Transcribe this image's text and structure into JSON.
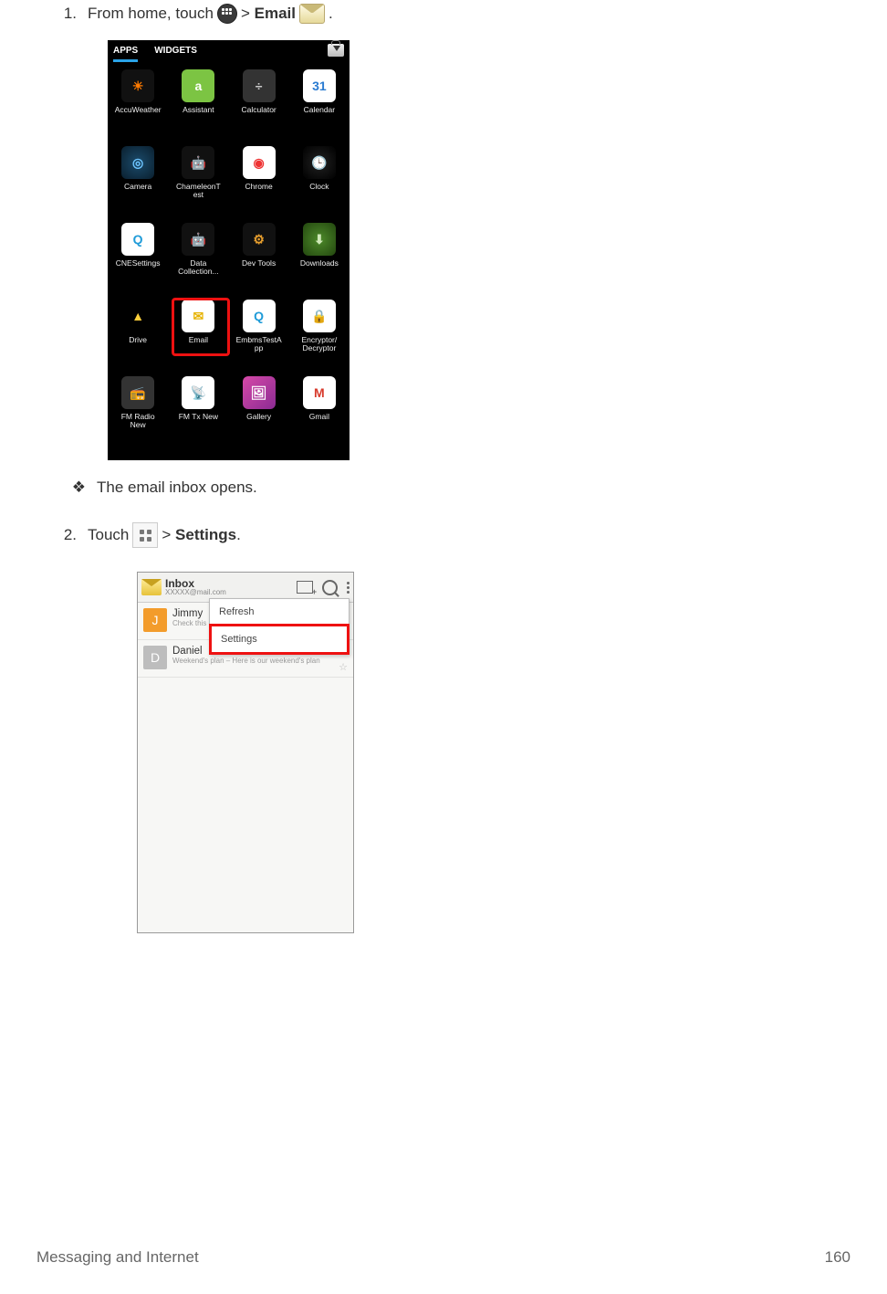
{
  "step1": {
    "number": "1.",
    "pre": "From home, touch",
    "gt1": ">",
    "email_label": "Email",
    "period": "."
  },
  "shot1": {
    "tab_apps": "APPS",
    "tab_widgets": "WIDGETS",
    "apps": [
      {
        "label": "AccuWeather",
        "bg": "#111",
        "inner": "☀",
        "ic": "#ff7a00"
      },
      {
        "label": "Assistant",
        "bg": "#7cc443",
        "inner": "a",
        "ic": "#fff"
      },
      {
        "label": "Calculator",
        "bg": "#333",
        "inner": "÷",
        "ic": "#ccc"
      },
      {
        "label": "Calendar",
        "bg": "#fff",
        "inner": "31",
        "ic": "#2a7bd1"
      },
      {
        "label": "Camera",
        "bg": "radial-gradient(circle,#1b4b6b,#0a1f2e)",
        "inner": "◎",
        "ic": "#6ec5ff"
      },
      {
        "label": "ChameleonT\nest",
        "bg": "#111",
        "inner": "🤖",
        "ic": "#8fd14f"
      },
      {
        "label": "Chrome",
        "bg": "#fff",
        "inner": "◉",
        "ic": "#e33"
      },
      {
        "label": "Clock",
        "bg": "radial-gradient(circle,#222,#000)",
        "inner": "🕒",
        "ic": "#eee"
      },
      {
        "label": "CNESettings",
        "bg": "#fff",
        "inner": "Q",
        "ic": "#1f9bd8"
      },
      {
        "label": "Data\nCollection...",
        "bg": "#111",
        "inner": "🤖",
        "ic": "#8fd14f"
      },
      {
        "label": "Dev Tools",
        "bg": "#111",
        "inner": "⚙",
        "ic": "#e89f2e"
      },
      {
        "label": "Downloads",
        "bg": "radial-gradient(circle,#4d8a2a,#23470f)",
        "inner": "⬇",
        "ic": "#cfe8b8"
      },
      {
        "label": "Drive",
        "bg": "#000",
        "inner": "▲",
        "ic": "#ffcf3a"
      },
      {
        "label": "Email",
        "bg": "#fff",
        "inner": "✉",
        "ic": "#e6b200"
      },
      {
        "label": "EmbmsTestA\npp",
        "bg": "#fff",
        "inner": "Q",
        "ic": "#1f9bd8"
      },
      {
        "label": "Encryptor/\nDecryptor",
        "bg": "#fff",
        "inner": "🔒",
        "ic": "#c33"
      },
      {
        "label": "FM Radio\nNew",
        "bg": "#333",
        "inner": "📻",
        "ic": "#aaa"
      },
      {
        "label": "FM Tx New",
        "bg": "#fff",
        "inner": "📡",
        "ic": "#555"
      },
      {
        "label": "Gallery",
        "bg": "linear-gradient(135deg,#d649a8,#8b2b93)",
        "inner": "🖼",
        "ic": "#fff"
      },
      {
        "label": "Gmail",
        "bg": "#fff",
        "inner": "M",
        "ic": "#d73a2c"
      }
    ]
  },
  "bullet": {
    "text": "The email inbox opens."
  },
  "step2": {
    "number": "2.",
    "pre": "Touch",
    "gt": ">",
    "settings_label": "Settings",
    "period": "."
  },
  "shot2": {
    "title": "Inbox",
    "account": "XXXXX@mail.com",
    "menu_refresh": "Refresh",
    "menu_settings": "Settings",
    "rows": [
      {
        "initial": "J",
        "color": "#f39c2b",
        "name": "Jimmy",
        "sub": "Check this ou"
      },
      {
        "initial": "D",
        "color": "#bdbdbd",
        "name": "Daniel",
        "sub": "Weekend's plan – Here is our weekend's plan"
      }
    ]
  },
  "footer": {
    "section": "Messaging and Internet",
    "page": "160"
  }
}
